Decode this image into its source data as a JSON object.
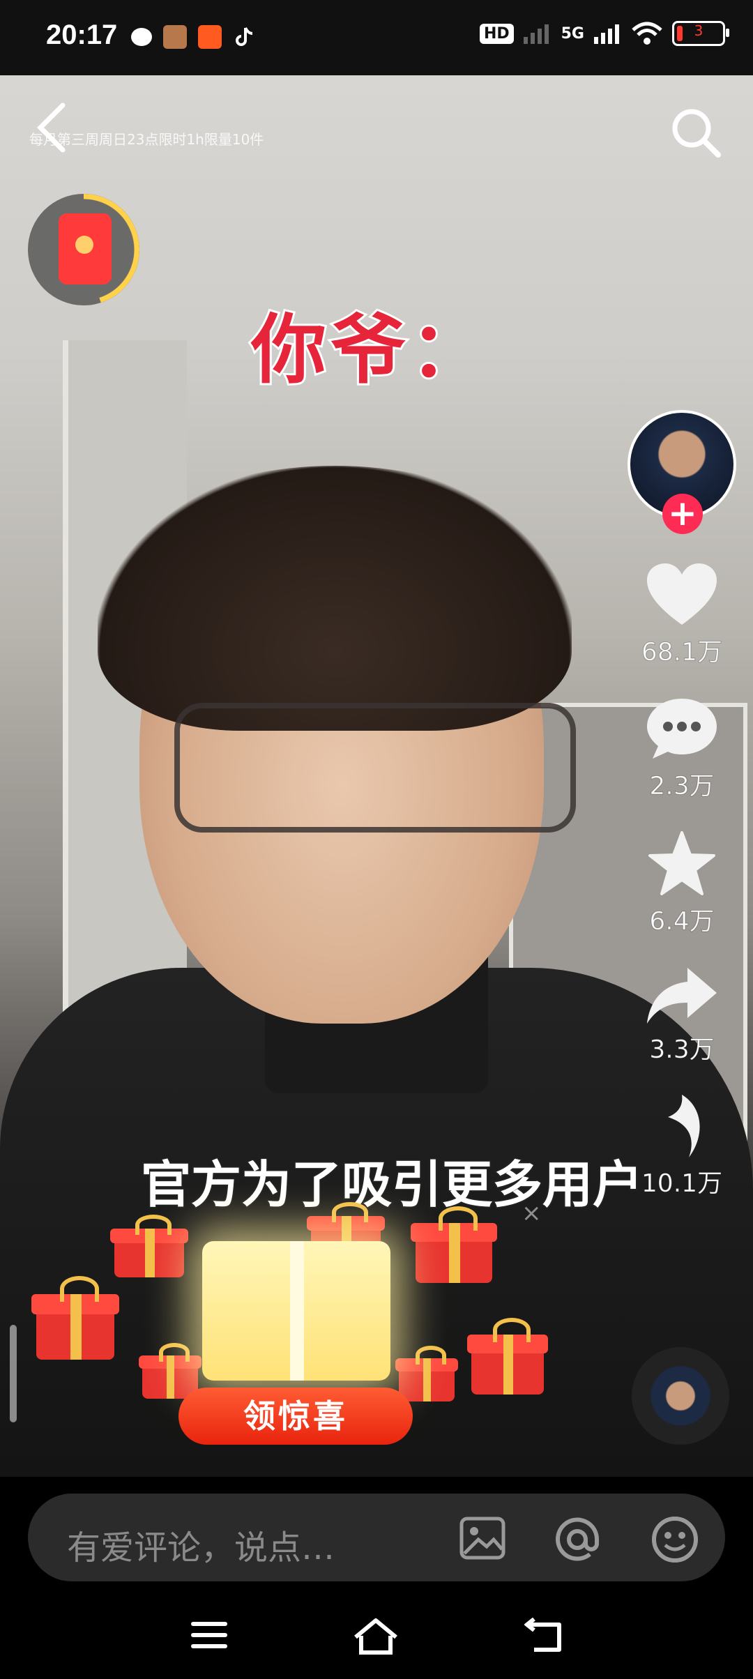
{
  "status_bar": {
    "time": "20:17",
    "network_hd": "HD",
    "network_type": "5G",
    "battery_level": "3",
    "battery_fraction": 0.03
  },
  "video": {
    "promo_text": "每月第三周周日23点限时1h限量10件",
    "caption_top": "你爷：",
    "caption_bottom": "官方为了吸引更多用户",
    "surprise_button": "领惊喜"
  },
  "actions": {
    "likes": "68.1万",
    "comments": "2.3万",
    "favorites": "6.4万",
    "shares": "3.3万",
    "recommend": "10.1万"
  },
  "comment_bar": {
    "placeholder": "有爱评论，说点…"
  },
  "icons": {
    "back": "back-icon",
    "search": "search-icon",
    "like": "heart-icon",
    "comment": "comment-icon",
    "favorite": "star-icon",
    "share": "share-icon",
    "recommend": "recommend-icon",
    "image": "image-icon",
    "mention": "at-icon",
    "emoji": "emoji-icon"
  },
  "colors": {
    "accent": "#fe2c55",
    "caption_red": "#e6253a",
    "button_orange": "#e8240e"
  }
}
